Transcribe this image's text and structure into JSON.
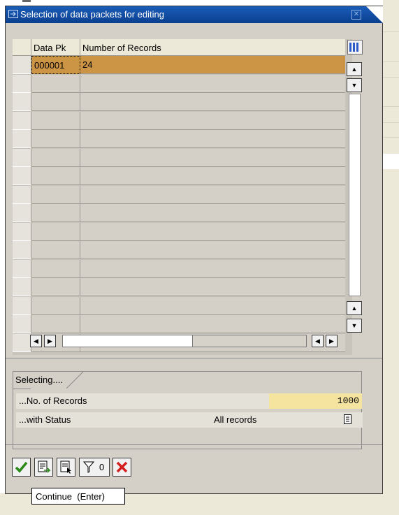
{
  "dialog": {
    "title": "Selection of data packets for editing",
    "close_glyph": "✕"
  },
  "table": {
    "columns": [
      "Data Pk",
      "Number of Records"
    ],
    "rows": [
      {
        "data_pk": "000001",
        "number_of_records": "24",
        "selected": true
      }
    ],
    "empty_rows": 15,
    "row_highlight_color": "#cc9445"
  },
  "selecting": {
    "group_label": "Selecting....",
    "records_label": "...No. of Records",
    "records_value": "1000",
    "status_label": "...with Status",
    "status_value": "All records"
  },
  "toolbar": {
    "continue_icon": "check-icon",
    "filter_count": "0",
    "cancel_icon": "cancel-icon"
  },
  "tooltip": {
    "text": "Continue  (Enter)"
  }
}
